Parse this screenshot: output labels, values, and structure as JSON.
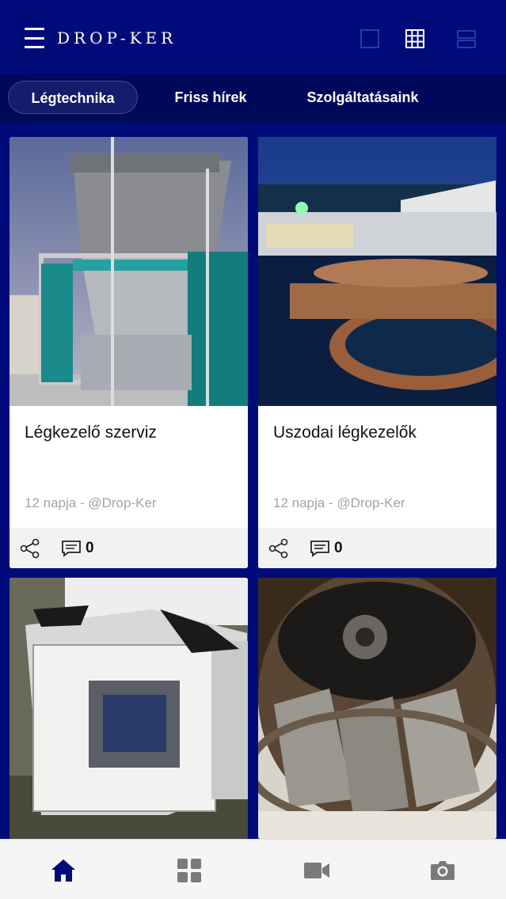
{
  "app": {
    "logo_text": "DROP-KER",
    "accent_color": "#000b7a"
  },
  "header": {
    "view_buttons": [
      {
        "icon": "single-view-icon",
        "active": false
      },
      {
        "icon": "grid-view-icon",
        "active": true
      },
      {
        "icon": "list-view-icon",
        "active": false
      }
    ]
  },
  "tabs": [
    {
      "label": "Légtechnika",
      "active": true
    },
    {
      "label": "Friss hírek",
      "active": false
    },
    {
      "label": "Szolgáltatásaink",
      "active": false
    }
  ],
  "cards": [
    {
      "title": "Légkezelő szerviz",
      "meta": "12 napja - @Drop-Ker",
      "comments": "0",
      "image": "air-handling-unit-photo"
    },
    {
      "title": "Uszodai légkezelők",
      "meta": "12 napja - @Drop-Ker",
      "comments": "0",
      "image": "outdoor-pool-night-photo"
    },
    {
      "title": "",
      "meta": "",
      "comments": "",
      "image": "white-hvac-units-photo"
    },
    {
      "title": "",
      "meta": "",
      "comments": "",
      "image": "fan-impeller-closeup-photo"
    }
  ],
  "bottom_nav": [
    {
      "icon": "home-icon",
      "active": true
    },
    {
      "icon": "categories-grid-icon",
      "active": false
    },
    {
      "icon": "video-camera-icon",
      "active": false
    },
    {
      "icon": "camera-icon",
      "active": false
    }
  ]
}
